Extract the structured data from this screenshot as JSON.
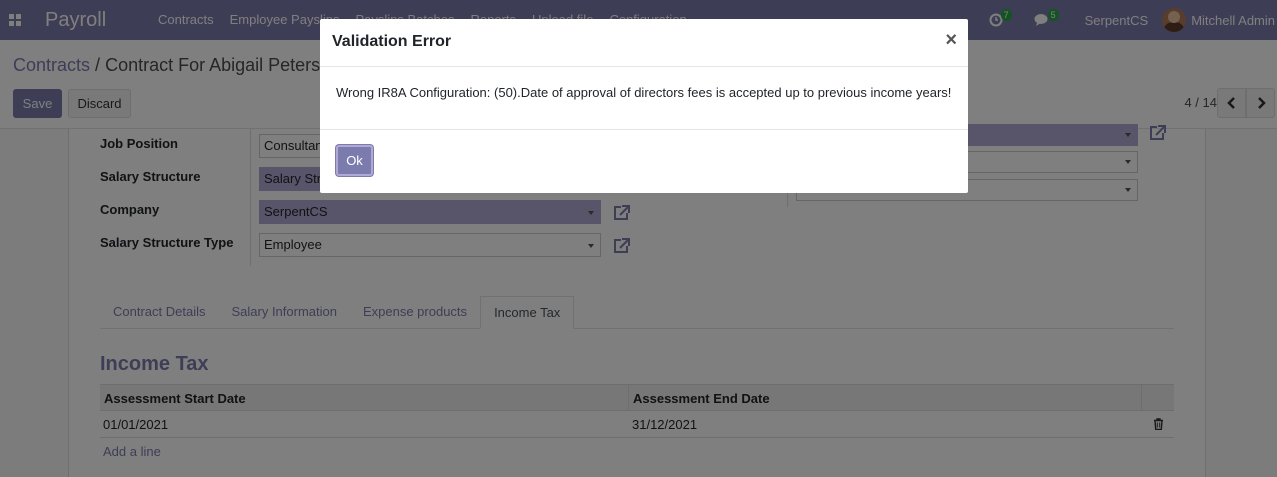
{
  "navbar": {
    "brand": "Payroll",
    "menu": [
      "Contracts",
      "Employee Payslips",
      "Payslips Batches",
      "Reports",
      "Upload file",
      "Configuration"
    ],
    "activity_count": "7",
    "message_count": "5",
    "company": "SerpentCS",
    "user": "Mitchell Admin"
  },
  "control": {
    "breadcrumb_root": "Contracts",
    "breadcrumb_sep": "/",
    "breadcrumb_current": "Contract For Abigail Peterson",
    "save_label": "Save",
    "discard_label": "Discard",
    "pager": "4 / 14"
  },
  "form": {
    "job_position_label": "Job Position",
    "job_position_value": "Consultant",
    "salary_structure_label": "Salary Structure",
    "salary_structure_value": "Salary Structure",
    "company_label": "Company",
    "company_value": "SerpentCS",
    "structure_type_label": "Salary Structure Type",
    "structure_type_value": "Employee"
  },
  "tabs": [
    "Contract Details",
    "Salary Information",
    "Expense products",
    "Income Tax"
  ],
  "income_tax": {
    "title": "Income Tax",
    "columns": [
      "Assessment Start Date",
      "Assessment End Date"
    ],
    "rows": [
      [
        "01/01/2021",
        "31/12/2021"
      ]
    ],
    "add_line": "Add a line"
  },
  "modal": {
    "title": "Validation Error",
    "close": "×",
    "message": "Wrong IR8A Configuration: (50).Date of approval of directors fees is accepted up to previous income years!",
    "ok_label": "Ok"
  },
  "colors": {
    "primary": "#7c7bad",
    "field_highlight": "#b0a9d4"
  }
}
